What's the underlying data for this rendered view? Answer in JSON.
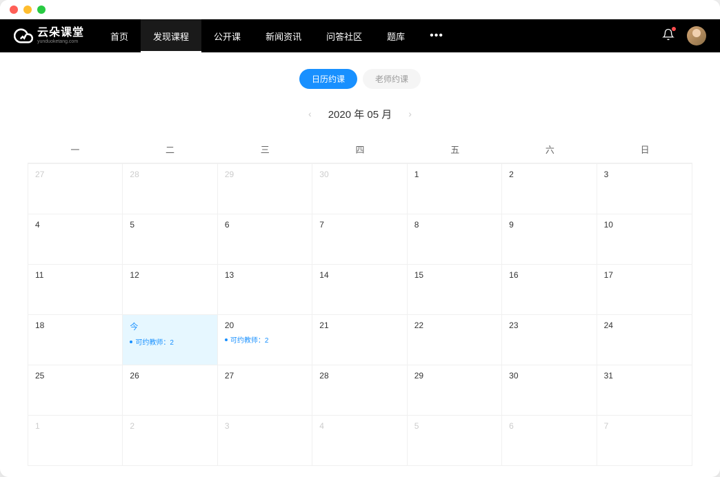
{
  "logo": {
    "main": "云朵课堂",
    "sub": "yunduoketang.com"
  },
  "nav": {
    "items": [
      "首页",
      "发现课程",
      "公开课",
      "新闻资讯",
      "问答社区",
      "题库"
    ],
    "activeIndex": 1
  },
  "tabs": {
    "calendar": "日历约课",
    "teacher": "老师约课"
  },
  "month": "2020 年 05 月",
  "weekdays": [
    "一",
    "二",
    "三",
    "四",
    "五",
    "六",
    "日"
  ],
  "todayLabel": "今",
  "event": "可约教师：2",
  "rows": [
    [
      {
        "n": "27",
        "o": true
      },
      {
        "n": "28",
        "o": true
      },
      {
        "n": "29",
        "o": true
      },
      {
        "n": "30",
        "o": true
      },
      {
        "n": "1"
      },
      {
        "n": "2"
      },
      {
        "n": "3"
      }
    ],
    [
      {
        "n": "4"
      },
      {
        "n": "5"
      },
      {
        "n": "6"
      },
      {
        "n": "7"
      },
      {
        "n": "8"
      },
      {
        "n": "9"
      },
      {
        "n": "10"
      }
    ],
    [
      {
        "n": "11"
      },
      {
        "n": "12"
      },
      {
        "n": "13"
      },
      {
        "n": "14"
      },
      {
        "n": "15"
      },
      {
        "n": "16"
      },
      {
        "n": "17"
      }
    ],
    [
      {
        "n": "18"
      },
      {
        "n": "今",
        "today": true,
        "ev": true
      },
      {
        "n": "20",
        "ev": true
      },
      {
        "n": "21"
      },
      {
        "n": "22"
      },
      {
        "n": "23"
      },
      {
        "n": "24"
      }
    ],
    [
      {
        "n": "25"
      },
      {
        "n": "26"
      },
      {
        "n": "27"
      },
      {
        "n": "28"
      },
      {
        "n": "29"
      },
      {
        "n": "30"
      },
      {
        "n": "31"
      }
    ],
    [
      {
        "n": "1",
        "o": true
      },
      {
        "n": "2",
        "o": true
      },
      {
        "n": "3",
        "o": true
      },
      {
        "n": "4",
        "o": true
      },
      {
        "n": "5",
        "o": true
      },
      {
        "n": "6",
        "o": true
      },
      {
        "n": "7",
        "o": true
      }
    ]
  ]
}
